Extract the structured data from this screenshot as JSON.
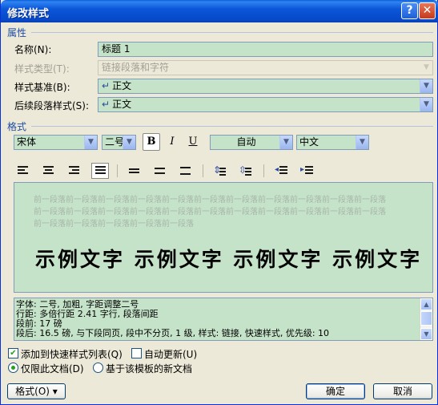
{
  "window": {
    "title": "修改样式",
    "help_glyph": "?",
    "close_glyph": "✕"
  },
  "properties": {
    "section_label": "属性",
    "name_label": "名称(N):",
    "name_value": "标题 1",
    "type_label": "样式类型(T):",
    "type_value": "链接段落和字符",
    "based_on_label": "样式基准(B):",
    "based_on_value": "正文",
    "following_label": "后续段落样式(S):",
    "following_value": "正文"
  },
  "format": {
    "section_label": "格式",
    "font": "宋体",
    "size": "二号",
    "bold_label": "B",
    "italic_label": "I",
    "underline_label": "U",
    "color": "自动",
    "script": "中文"
  },
  "preview": {
    "prev_para_lines": [
      "前一段落前一段落前一段落前一段落前一段落前一段落前一段落前一段落前一段落前一段落前一段落",
      "前一段落前一段落前一段落前一段落前一段落前一段落前一段落前一段落前一段落前一段落前一段落",
      "前一段落前一段落前一段落前一段落前一段落"
    ],
    "sample_text": "示例文字 示例文字 示例文字 示例文字"
  },
  "description": {
    "lines": [
      "字体: 二号, 加粗, 字距调整二号",
      "    行距:  多倍行距 2.41 字行, 段落间距",
      "    段前:  17 磅",
      "    段后:  16.5 磅, 与下段同页, 段中不分页, 1 级, 样式: 链接, 快速样式, 优先级: 10"
    ]
  },
  "options": {
    "add_to_quick": "添加到快速样式列表(Q)",
    "add_to_quick_checked": true,
    "auto_update": "自动更新(U)",
    "auto_update_checked": false,
    "this_doc_only": "仅限此文档(D)",
    "this_doc_selected": true,
    "new_docs": "基于该模板的新文档"
  },
  "buttons": {
    "format": "格式(O) ▾",
    "ok": "确定",
    "cancel": "取消"
  },
  "colors": {
    "title_bar": "#0b57d8",
    "dialog_bg": "#ece9d8",
    "field_bg": "#c5e3c8",
    "section_label": "#1f4ea8"
  }
}
